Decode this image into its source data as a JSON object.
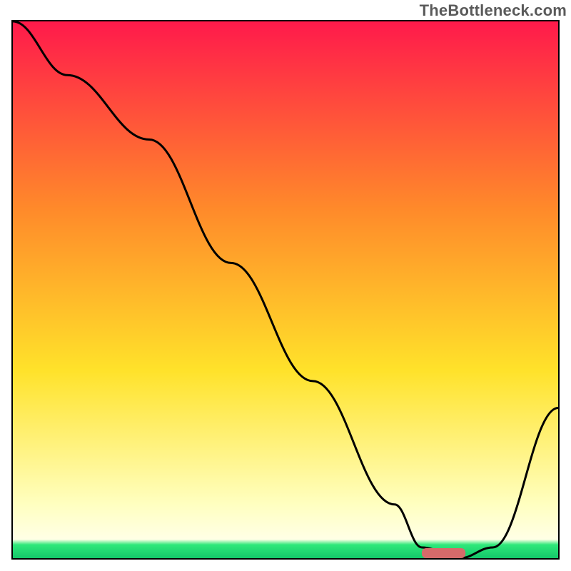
{
  "watermark": "TheBottleneck.com",
  "colors": {
    "gradient_top": "#ff1a4b",
    "gradient_mid1": "#ff8a2a",
    "gradient_mid2": "#ffe22a",
    "gradient_pale": "#ffffc0",
    "gradient_bottom_band": "#2ee87a",
    "frame": "#000000",
    "curve": "#000000",
    "marker": "#d66a6a"
  },
  "chart_data": {
    "type": "line",
    "title": "",
    "xlabel": "",
    "ylabel": "",
    "xlim": [
      0,
      100
    ],
    "ylim": [
      0,
      100
    ],
    "series": [
      {
        "name": "bottleneck-curve",
        "x": [
          0,
          10,
          25,
          40,
          55,
          70,
          75,
          82,
          88,
          100
        ],
        "values": [
          100,
          90,
          78,
          55,
          33,
          10,
          2,
          0,
          2,
          28
        ]
      }
    ],
    "annotations": [
      {
        "name": "optimal-marker",
        "shape": "rounded-bar",
        "x_range": [
          75,
          83
        ],
        "y": 0,
        "color": "#d66a6a"
      }
    ],
    "background_gradient": {
      "direction": "vertical",
      "stops": [
        {
          "offset": 0.0,
          "color": "#ff1a4b"
        },
        {
          "offset": 0.35,
          "color": "#ff8a2a"
        },
        {
          "offset": 0.65,
          "color": "#ffe22a"
        },
        {
          "offset": 0.9,
          "color": "#ffffc0"
        },
        {
          "offset": 0.965,
          "color": "#ffffe6"
        },
        {
          "offset": 0.975,
          "color": "#2ee87a"
        },
        {
          "offset": 1.0,
          "color": "#14c76a"
        }
      ]
    }
  }
}
